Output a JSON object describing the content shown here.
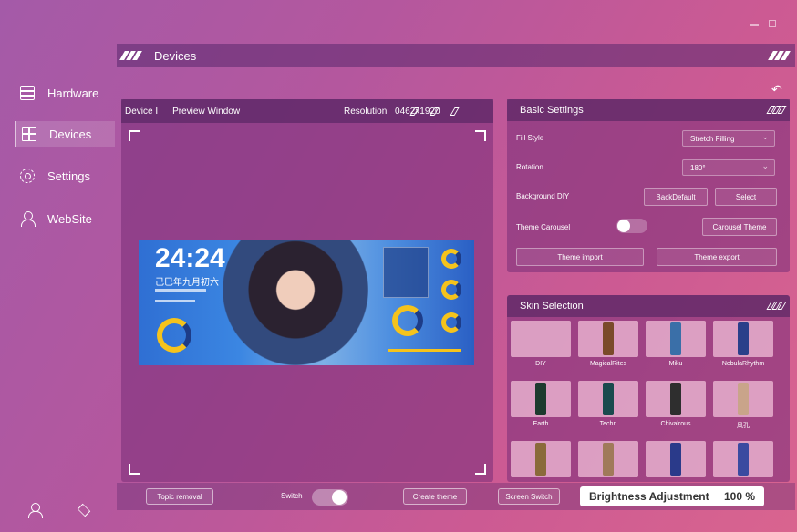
{
  "window": {
    "controls": [
      "minimize",
      "maximize"
    ]
  },
  "sidebar": {
    "items": [
      {
        "label": "Hardware",
        "icon": "hardware-icon",
        "active": false
      },
      {
        "label": "Devices",
        "icon": "devices-icon",
        "active": true
      },
      {
        "label": "Settings",
        "icon": "settings-icon",
        "active": false
      },
      {
        "label": "WebSite",
        "icon": "website-icon",
        "active": false
      }
    ],
    "bottom_icons": [
      "user-icon",
      "layers-icon"
    ]
  },
  "header": {
    "title": "Devices"
  },
  "preview": {
    "device": "Device I",
    "title": "Preview Window",
    "resolution_label": "Resolution",
    "resolution_value": "0462x1920",
    "screen": {
      "clock": "24:24",
      "date_line": "己巳年九月初六"
    }
  },
  "basic_settings": {
    "title": "Basic Settings",
    "fill_style_label": "Fill Style",
    "fill_style_value": "Stretch Filling",
    "rotation_label": "Rotation",
    "rotation_value": "180°",
    "background_label": "Background DIY",
    "back_default": "BackDefault",
    "select": "Select",
    "theme_carousel_label": "Theme Carousel",
    "carousel_theme": "Carousel Theme",
    "theme_import": "Theme import",
    "theme_export": "Theme export"
  },
  "skin_selection": {
    "title": "Skin Selection",
    "items": [
      {
        "label": "DIY",
        "color": ""
      },
      {
        "label": "MagicalRites",
        "color": "#7a4a2a"
      },
      {
        "label": "Miku",
        "color": "#3a6fa8"
      },
      {
        "label": "NebulaRhythm",
        "color": "#2a3f8a"
      },
      {
        "label": "Earth",
        "color": "#1d3a2e"
      },
      {
        "label": "Techn",
        "color": "#1a4a4e"
      },
      {
        "label": "Chivalrous",
        "color": "#2e2e2e"
      },
      {
        "label": "风孔",
        "color": "#c9a48a"
      },
      {
        "label": "",
        "color": "#8a6a3a"
      },
      {
        "label": "",
        "color": "#a07a5a"
      },
      {
        "label": "",
        "color": "#2a3a8a"
      },
      {
        "label": "",
        "color": "#3a4aa0"
      }
    ]
  },
  "toolbar": {
    "topic_removal": "Topic removal",
    "switch_label": "Switch",
    "create_theme": "Create theme",
    "screen_switch": "Screen Switch",
    "brightness_label": "Brightness Adjustment",
    "brightness_value": "100 %"
  }
}
